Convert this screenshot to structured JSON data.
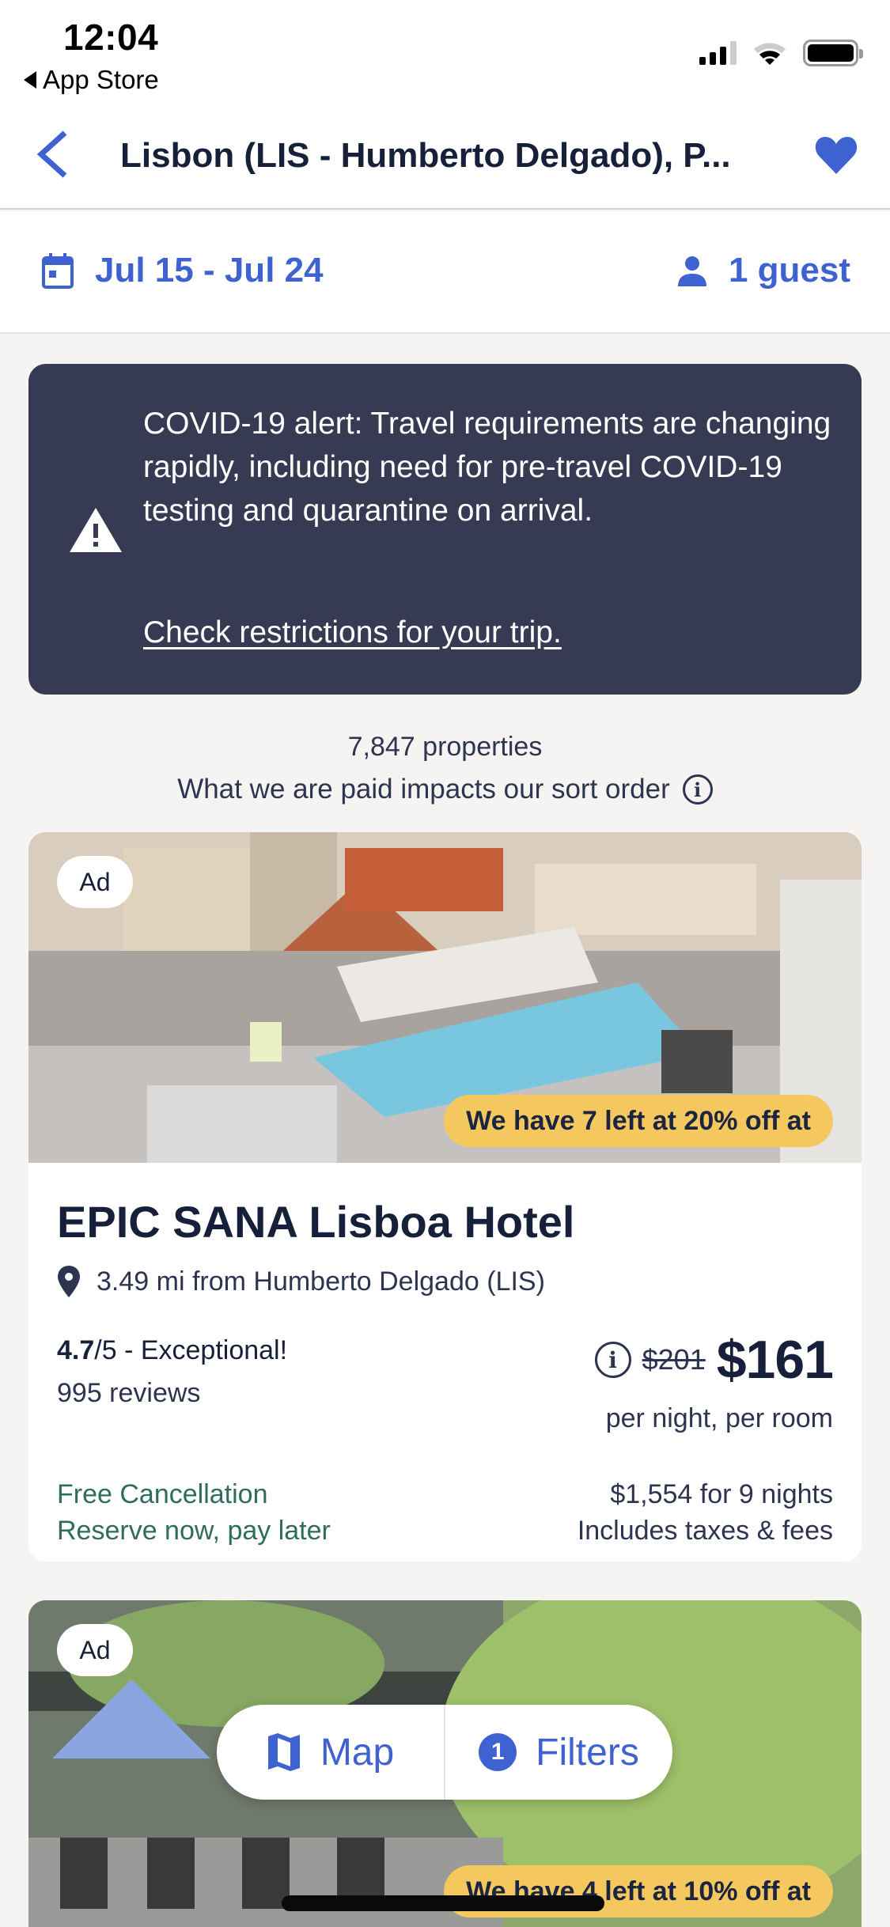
{
  "status_bar": {
    "time": "12:04",
    "back_app": "App Store",
    "icons": [
      "cellular-signal-icon",
      "wifi-icon",
      "battery-icon"
    ]
  },
  "nav": {
    "title": "Lisbon (LIS - Humberto Delgado), P...",
    "back_icon": "chevron-left-icon",
    "favorite_icon": "heart-icon"
  },
  "trip": {
    "dates": "Jul 15 - Jul 24",
    "guests": "1 guest",
    "date_icon": "calendar-icon",
    "guest_icon": "person-icon"
  },
  "alert": {
    "icon": "warning-icon",
    "message": "COVID-19 alert: Travel requirements are changing rapidly, including need for pre-travel COVID-19 testing and quarantine on arrival.",
    "link": "Check restrictions for your trip."
  },
  "results": {
    "count": "7,847 properties",
    "sort_note": "What we are paid impacts our sort order"
  },
  "listings": [
    {
      "ad_label": "Ad",
      "deal": "We have 7 left at 20% off at",
      "name": "EPIC SANA Lisboa Hotel",
      "distance": "3.49 mi from Humberto Delgado (LIS)",
      "rating_score": "4.7",
      "rating_suffix": "/5 - Exceptional!",
      "reviews": "995 reviews",
      "old_price": "$201",
      "price": "$161",
      "price_unit": "per night, per room",
      "cancellation": "Free Cancellation",
      "payment": "Reserve now, pay later",
      "total": "$1,554 for 9 nights",
      "taxes": "Includes taxes & fees"
    },
    {
      "ad_label": "Ad",
      "deal": "We have 4 left at 10% off at"
    }
  ],
  "fab": {
    "map_label": "Map",
    "filters_label": "Filters",
    "filters_count": "1"
  },
  "colors": {
    "accent": "#3e63d1",
    "alert_bg": "#363a52",
    "deal_badge": "#f5c85f",
    "green_text": "#2e6d5e",
    "text_dark": "#17203a",
    "page_bg": "#f5f4f2"
  }
}
